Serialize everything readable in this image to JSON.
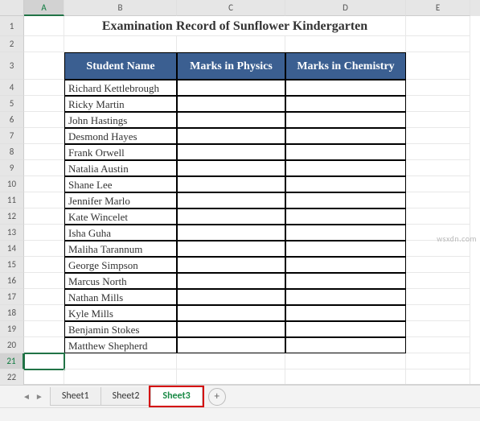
{
  "columns": [
    "A",
    "B",
    "C",
    "D",
    "E"
  ],
  "rows": [
    "1",
    "2",
    "3",
    "4",
    "5",
    "6",
    "7",
    "8",
    "9",
    "10",
    "11",
    "12",
    "13",
    "14",
    "15",
    "16",
    "17",
    "18",
    "19",
    "20",
    "21",
    "22"
  ],
  "title": "Examination Record of Sunflower Kindergarten",
  "table_headers": {
    "B": "Student Name",
    "C": "Marks in Physics",
    "D": "Marks in Chemistry"
  },
  "students": [
    "Richard Kettlebrough",
    "Ricky Martin",
    "John Hastings",
    "Desmond Hayes",
    "Frank Orwell",
    "Natalia Austin",
    "Shane Lee",
    "Jennifer Marlo",
    "Kate Wincelet",
    "Isha Guha",
    "Maliha Tarannum",
    "George Simpson",
    "Marcus North",
    "Nathan Mills",
    "Kyle Mills",
    "Benjamin Stokes",
    "Matthew Shepherd"
  ],
  "tabs": {
    "items": [
      "Sheet1",
      "Sheet2",
      "Sheet3"
    ],
    "active": "Sheet3",
    "add": "+"
  },
  "nav": {
    "first": "◄",
    "prev": "◄",
    "next": "►",
    "last": "►"
  },
  "watermark": "wsxdn.com",
  "selected_row": "21",
  "selected_col": "A"
}
